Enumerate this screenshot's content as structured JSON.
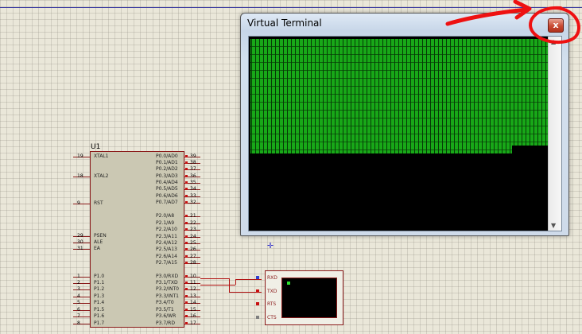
{
  "schematic": {
    "mcu": {
      "ref": "U1",
      "left_pins": [
        {
          "num": "19",
          "name": "XTAL1"
        },
        {
          "num": "18",
          "name": "XTAL2"
        },
        {
          "num": "9",
          "name": "RST"
        },
        {
          "num": "29",
          "name": "PSEN"
        },
        {
          "num": "30",
          "name": "ALE"
        },
        {
          "num": "31",
          "name": "EA"
        },
        {
          "num": "1",
          "name": "P1.0"
        },
        {
          "num": "2",
          "name": "P1.1"
        },
        {
          "num": "3",
          "name": "P1.2"
        },
        {
          "num": "4",
          "name": "P1.3"
        },
        {
          "num": "5",
          "name": "P1.4"
        },
        {
          "num": "6",
          "name": "P1.5"
        },
        {
          "num": "7",
          "name": "P1.6"
        },
        {
          "num": "8",
          "name": "P1.7"
        }
      ],
      "right_pins": [
        {
          "num": "39",
          "name": "P0.0/AD0"
        },
        {
          "num": "38",
          "name": "P0.1/AD1"
        },
        {
          "num": "37",
          "name": "P0.2/AD2"
        },
        {
          "num": "36",
          "name": "P0.3/AD3"
        },
        {
          "num": "35",
          "name": "P0.4/AD4"
        },
        {
          "num": "34",
          "name": "P0.5/AD5"
        },
        {
          "num": "33",
          "name": "P0.6/AD6"
        },
        {
          "num": "32",
          "name": "P0.7/AD7"
        },
        {
          "num": "21",
          "name": "P2.0/A8"
        },
        {
          "num": "22",
          "name": "P2.1/A9"
        },
        {
          "num": "23",
          "name": "P2.2/A10"
        },
        {
          "num": "24",
          "name": "P2.3/A11"
        },
        {
          "num": "25",
          "name": "P2.4/A12"
        },
        {
          "num": "26",
          "name": "P2.5/A13"
        },
        {
          "num": "27",
          "name": "P2.6/A14"
        },
        {
          "num": "28",
          "name": "P2.7/A15"
        },
        {
          "num": "10",
          "name": "P3.0/RXD"
        },
        {
          "num": "11",
          "name": "P3.1/TXD"
        },
        {
          "num": "12",
          "name": "P3.2/INT0"
        },
        {
          "num": "13",
          "name": "P3.3/INT1"
        },
        {
          "num": "14",
          "name": "P3.4/T0"
        },
        {
          "num": "15",
          "name": "P3.5/T1"
        },
        {
          "num": "16",
          "name": "P3.6/WR"
        },
        {
          "num": "17",
          "name": "P3.7/RD"
        }
      ]
    },
    "terminal_part": {
      "pins": [
        "RXD",
        "TXD",
        "RTS",
        "CTS"
      ],
      "pin_colors": [
        "#3040d0",
        "#c81010",
        "#c81010",
        "#808080"
      ]
    }
  },
  "window": {
    "title": "Virtual Terminal",
    "close_label": "x",
    "scroll_up": "▲",
    "scroll_down": "▼"
  },
  "annotation": {
    "color": "#ee1111",
    "description_icon": "red-arrow-and-circle-around-close"
  }
}
